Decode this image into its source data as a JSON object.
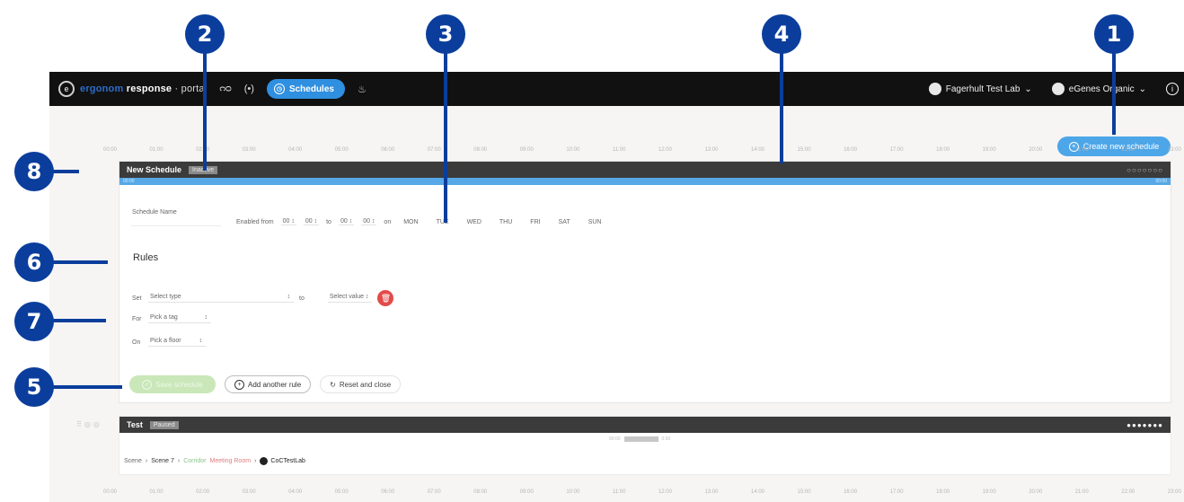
{
  "callouts": [
    "1",
    "2",
    "3",
    "4",
    "5",
    "6",
    "7",
    "8"
  ],
  "topbar": {
    "logo_part1": "ergonom",
    "logo_part2": "response",
    "logo_part3": "· portal",
    "nav_icon_1": "ᴒᴑ",
    "nav_icon_2": "(•)",
    "active_tab": "Schedules",
    "lab": "Fagerhult Test Lab",
    "org": "eGenes Organic"
  },
  "create_button": "Create new schedule",
  "timeline_labels": [
    "00:00",
    "01:00",
    "02:00",
    "03:00",
    "04:00",
    "05:00",
    "06:00",
    "07:00",
    "08:00",
    "09:00",
    "10:00",
    "11:00",
    "12:00",
    "13:00",
    "14:00",
    "15:00",
    "16:00",
    "17:00",
    "18:00",
    "19:00",
    "20:00",
    "21:00",
    "22:00",
    "23:00"
  ],
  "schedule1": {
    "title": "New Schedule",
    "status": "Inactive",
    "bar_start": "00:00",
    "bar_end": "00:00",
    "name_label": "Schedule Name",
    "enabled_from": "Enabled from",
    "h1": "00 ↕",
    "m1": "00 ↕",
    "to": "to",
    "h2": "00 ↕",
    "m2": "00 ↕",
    "on": "on",
    "days": [
      "MON",
      "TUE",
      "WED",
      "THU",
      "FRI",
      "SAT",
      "SUN"
    ],
    "rules_title": "Rules",
    "set_label": "Set",
    "select_type": "Select type",
    "to_label": "to",
    "select_value": "Select value ↕",
    "for_label": "For",
    "pick_tag": "Pick a tag",
    "on_label": "On",
    "pick_floor": "Pick a floor",
    "save": "Save schedule",
    "add_rule": "Add another rule",
    "reset": "Reset and close"
  },
  "schedule2": {
    "title": "Test",
    "status": "Paused",
    "bar_left": "00:00",
    "bar_right": "0:00",
    "scene": "Scene",
    "arrow1": "›",
    "scene_value": "Scene 7",
    "arrow2": "›",
    "rule_green": "Corridor",
    "rule_red": "Meeting Room",
    "arrow3": "›",
    "lab": "CoCTestLab"
  }
}
